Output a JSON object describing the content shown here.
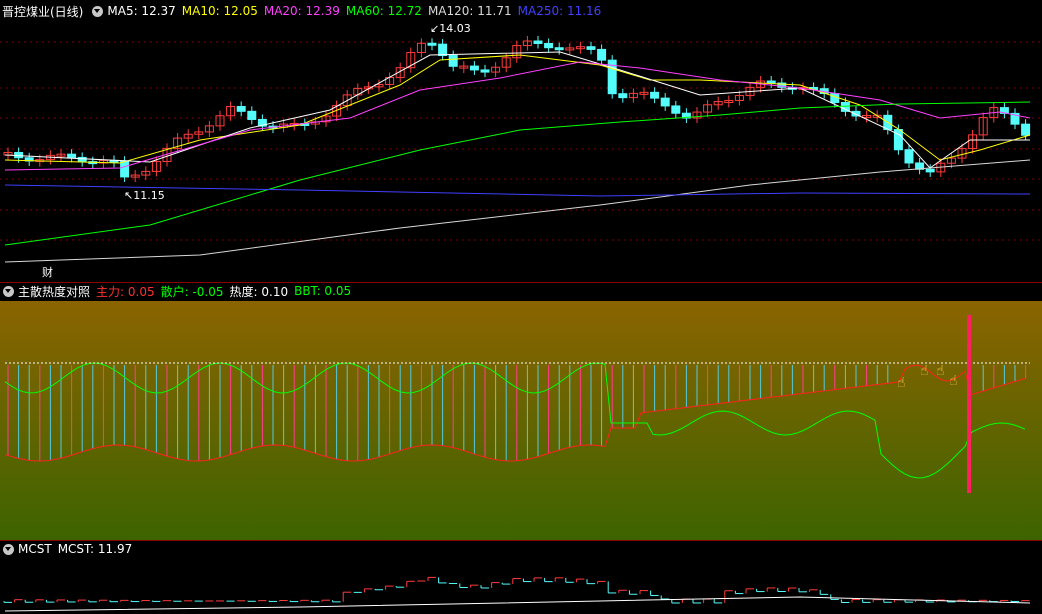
{
  "main": {
    "title": "晋控煤业(日线)",
    "ma": [
      {
        "label": "MA5: 12.37",
        "color": "#ffffff"
      },
      {
        "label": "MA10: 12.05",
        "color": "#ffff00"
      },
      {
        "label": "MA20: 12.39",
        "color": "#ff40ff"
      },
      {
        "label": "MA60: 12.72",
        "color": "#00ff00"
      },
      {
        "label": "MA120: 11.71",
        "color": "#d8d8d8"
      },
      {
        "label": "MA250: 11.16",
        "color": "#4040ff"
      }
    ],
    "high_label": "14.03",
    "low_label": "11.15",
    "fin_badge": "财"
  },
  "indicator": {
    "title": "主散热度对照",
    "items": [
      {
        "label": "主力: 0.05",
        "color": "#ff3030"
      },
      {
        "label": "散户: -0.05",
        "color": "#00ff00"
      },
      {
        "label": "热度: 0.10",
        "color": "#ffffff"
      },
      {
        "label": "BBT: 0.05",
        "color": "#00ff00"
      }
    ]
  },
  "mcst": {
    "title": "MCST",
    "value_label": "MCST: 11.97"
  },
  "colors": {
    "up": "#ff3c3c",
    "down": "#54fcfc",
    "grid": "#800000",
    "gradient_top": "#8b6400",
    "gradient_bottom": "#3d6400"
  }
}
